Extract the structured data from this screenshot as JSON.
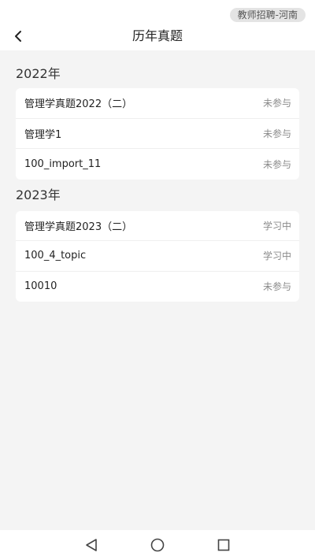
{
  "status_bar": {
    "context_tag": "教师招聘-河南"
  },
  "header": {
    "title": "历年真题"
  },
  "sections": [
    {
      "year": "2022年",
      "items": [
        {
          "title": "管理学真题2022（二）",
          "status": "未参与"
        },
        {
          "title": "管理学1",
          "status": "未参与"
        },
        {
          "title": "100_import_11",
          "status": "未参与"
        }
      ]
    },
    {
      "year": "2023年",
      "items": [
        {
          "title": "管理学真题2023（二）",
          "status": "学习中"
        },
        {
          "title": "100_4_topic",
          "status": "学习中"
        },
        {
          "title": "10010",
          "status": "未参与"
        }
      ]
    }
  ],
  "system_nav": {
    "back_icon": "triangle-back",
    "home_icon": "circle-home",
    "recents_icon": "square-recents"
  },
  "colors": {
    "background": "#f4f4f4",
    "card": "#ffffff",
    "status_text": "#8a8a8a"
  }
}
